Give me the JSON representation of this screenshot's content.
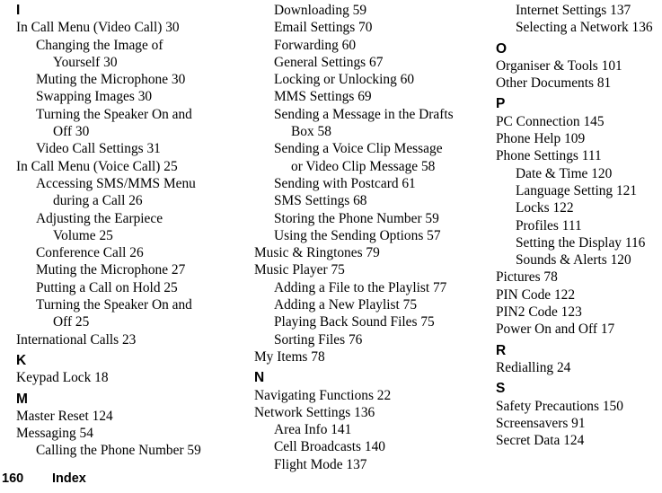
{
  "document": {
    "kind": "book-index-page",
    "footer": {
      "page_number": "160",
      "label": "Index"
    }
  },
  "columns": [
    {
      "id": "column-1",
      "blocks": [
        {
          "type": "letter",
          "text": "I"
        },
        {
          "type": "entry",
          "level": 1,
          "text": "In Call Menu (Video Call) 30"
        },
        {
          "type": "entry",
          "level": 2,
          "text": "Changing the Image of"
        },
        {
          "type": "entry",
          "level": 3,
          "text": "Yourself 30"
        },
        {
          "type": "entry",
          "level": 2,
          "text": "Muting the Microphone 30"
        },
        {
          "type": "entry",
          "level": 2,
          "text": "Swapping Images 30"
        },
        {
          "type": "entry",
          "level": 2,
          "text": "Turning the Speaker On and"
        },
        {
          "type": "entry",
          "level": 3,
          "text": "Off 30"
        },
        {
          "type": "entry",
          "level": 2,
          "text": "Video Call Settings 31"
        },
        {
          "type": "entry",
          "level": 1,
          "text": "In Call Menu (Voice Call) 25"
        },
        {
          "type": "entry",
          "level": 2,
          "text": "Accessing SMS/MMS Menu"
        },
        {
          "type": "entry",
          "level": 3,
          "text": "during a Call 26"
        },
        {
          "type": "entry",
          "level": 2,
          "text": "Adjusting the Earpiece"
        },
        {
          "type": "entry",
          "level": 3,
          "text": "Volume 25"
        },
        {
          "type": "entry",
          "level": 2,
          "text": "Conference Call 26"
        },
        {
          "type": "entry",
          "level": 2,
          "text": "Muting the Microphone 27"
        },
        {
          "type": "entry",
          "level": 2,
          "text": "Putting a Call on Hold 25"
        },
        {
          "type": "entry",
          "level": 2,
          "text": "Turning the Speaker On and"
        },
        {
          "type": "entry",
          "level": 3,
          "text": "Off 25"
        },
        {
          "type": "entry",
          "level": 1,
          "text": "International Calls 23"
        },
        {
          "type": "letter",
          "text": "K"
        },
        {
          "type": "entry",
          "level": 1,
          "text": "Keypad Lock 18"
        },
        {
          "type": "letter",
          "text": "M"
        },
        {
          "type": "entry",
          "level": 1,
          "text": "Master Reset 124"
        },
        {
          "type": "entry",
          "level": 1,
          "text": "Messaging 54"
        },
        {
          "type": "entry",
          "level": 2,
          "text": "Calling the Phone Number 59"
        }
      ]
    },
    {
      "id": "column-2",
      "blocks": [
        {
          "type": "entry",
          "level": 2,
          "text": "Downloading 59"
        },
        {
          "type": "entry",
          "level": 2,
          "text": "Email Settings 70"
        },
        {
          "type": "entry",
          "level": 2,
          "text": "Forwarding 60"
        },
        {
          "type": "entry",
          "level": 2,
          "text": "General Settings 67"
        },
        {
          "type": "entry",
          "level": 2,
          "text": "Locking or Unlocking 60"
        },
        {
          "type": "entry",
          "level": 2,
          "text": "MMS Settings 69"
        },
        {
          "type": "entry",
          "level": 2,
          "text": "Sending a Message in the Drafts"
        },
        {
          "type": "entry",
          "level": 3,
          "text": "Box 58"
        },
        {
          "type": "entry",
          "level": 2,
          "text": "Sending a Voice Clip Message"
        },
        {
          "type": "entry",
          "level": 3,
          "text": "or Video Clip Message 58"
        },
        {
          "type": "entry",
          "level": 2,
          "text": "Sending with Postcard 61"
        },
        {
          "type": "entry",
          "level": 2,
          "text": "SMS Settings 68"
        },
        {
          "type": "entry",
          "level": 2,
          "text": "Storing the Phone Number 59"
        },
        {
          "type": "entry",
          "level": 2,
          "text": "Using the Sending Options 57"
        },
        {
          "type": "entry",
          "level": 1,
          "text": "Music & Ringtones 79"
        },
        {
          "type": "entry",
          "level": 1,
          "text": "Music Player 75"
        },
        {
          "type": "entry",
          "level": 2,
          "text": "Adding a File to the Playlist 77"
        },
        {
          "type": "entry",
          "level": 2,
          "text": "Adding a New Playlist 75"
        },
        {
          "type": "entry",
          "level": 2,
          "text": "Playing Back Sound Files 75"
        },
        {
          "type": "entry",
          "level": 2,
          "text": "Sorting Files 76"
        },
        {
          "type": "entry",
          "level": 1,
          "text": "My Items 78"
        },
        {
          "type": "letter",
          "text": "N"
        },
        {
          "type": "entry",
          "level": 1,
          "text": "Navigating Functions 22"
        },
        {
          "type": "entry",
          "level": 1,
          "text": "Network Settings 136"
        },
        {
          "type": "entry",
          "level": 2,
          "text": "Area Info 141"
        },
        {
          "type": "entry",
          "level": 2,
          "text": "Cell Broadcasts 140"
        },
        {
          "type": "entry",
          "level": 2,
          "text": "Flight Mode 137"
        }
      ]
    },
    {
      "id": "column-3",
      "blocks": [
        {
          "type": "entry",
          "level": 2,
          "text": "Internet Settings 137"
        },
        {
          "type": "entry",
          "level": 2,
          "text": "Selecting a Network 136"
        },
        {
          "type": "letter",
          "text": "O"
        },
        {
          "type": "entry",
          "level": 1,
          "text": "Organiser & Tools 101"
        },
        {
          "type": "entry",
          "level": 1,
          "text": "Other Documents 81"
        },
        {
          "type": "letter",
          "text": "P"
        },
        {
          "type": "entry",
          "level": 1,
          "text": "PC Connection 145"
        },
        {
          "type": "entry",
          "level": 1,
          "text": "Phone Help 109"
        },
        {
          "type": "entry",
          "level": 1,
          "text": "Phone Settings 111"
        },
        {
          "type": "entry",
          "level": 2,
          "text": "Date & Time 120"
        },
        {
          "type": "entry",
          "level": 2,
          "text": "Language Setting 121"
        },
        {
          "type": "entry",
          "level": 2,
          "text": "Locks 122"
        },
        {
          "type": "entry",
          "level": 2,
          "text": "Profiles 111"
        },
        {
          "type": "entry",
          "level": 2,
          "text": "Setting the Display 116"
        },
        {
          "type": "entry",
          "level": 2,
          "text": "Sounds & Alerts 120"
        },
        {
          "type": "entry",
          "level": 1,
          "text": "Pictures 78"
        },
        {
          "type": "entry",
          "level": 1,
          "text": "PIN Code 122"
        },
        {
          "type": "entry",
          "level": 1,
          "text": "PIN2 Code 123"
        },
        {
          "type": "entry",
          "level": 1,
          "text": "Power On and Off 17"
        },
        {
          "type": "letter",
          "text": "R"
        },
        {
          "type": "entry",
          "level": 1,
          "text": "Redialling 24"
        },
        {
          "type": "letter",
          "text": "S"
        },
        {
          "type": "entry",
          "level": 1,
          "text": "Safety Precautions 150"
        },
        {
          "type": "entry",
          "level": 1,
          "text": "Screensavers 91"
        },
        {
          "type": "entry",
          "level": 1,
          "text": "Secret Data 124"
        }
      ]
    }
  ]
}
